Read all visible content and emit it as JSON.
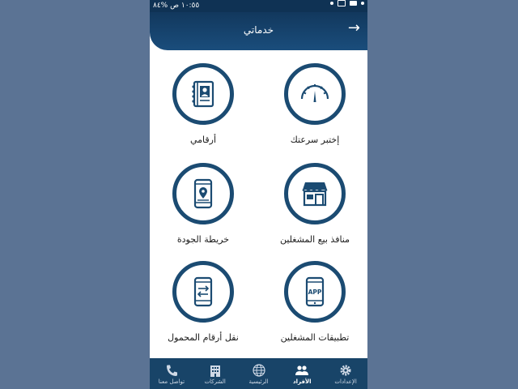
{
  "statusbar": {
    "time": "١٠:٥٥ ص",
    "battery": "%٨٤"
  },
  "header": {
    "title": "خدماتي"
  },
  "tiles": [
    {
      "label": "إختبر سرعتك",
      "icon": "speedometer-icon"
    },
    {
      "label": "أرقامي",
      "icon": "contact-book-icon"
    },
    {
      "label": "منافذ بيع المشغلين",
      "icon": "store-icon"
    },
    {
      "label": "خريطة الجودة",
      "icon": "phone-map-pin-icon"
    },
    {
      "label": "تطبيقات المشغلين",
      "icon": "phone-app-icon"
    },
    {
      "label": "نقل أرقام المحمول",
      "icon": "phone-transfer-icon"
    }
  ],
  "app_icon_text": "APP",
  "bottom_nav": [
    {
      "label": "الإعدادات",
      "icon": "gear-icon"
    },
    {
      "label": "الأفراد",
      "icon": "people-icon"
    },
    {
      "label": "الرئيسية",
      "icon": "globe-icon"
    },
    {
      "label": "الشركات",
      "icon": "building-icon"
    },
    {
      "label": "تواصل معنا",
      "icon": "phone-icon"
    }
  ],
  "colors": {
    "primary": "#1b4b72",
    "header": "#12385d",
    "background": "#5b7394"
  }
}
